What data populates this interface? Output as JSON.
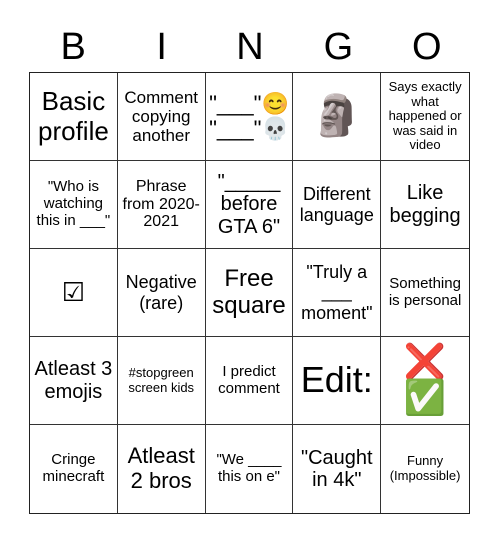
{
  "header": {
    "letters": [
      "B",
      "I",
      "N",
      "G",
      "O"
    ]
  },
  "board": {
    "cells": [
      "Basic profile",
      "Comment copying another",
      "\"___\"😊 \"___\"💀",
      "🗿",
      "Says exactly what happened or was said in video",
      "\"Who is watching this in ___\"",
      "Phrase from 2020-2021",
      "\"_____ before GTA 6\"",
      "Different language",
      "Like begging",
      "☑",
      "Negative (rare)",
      "Free square",
      "\"Truly a ___ moment\"",
      "Something is personal",
      "Atleast 3 emojis",
      "#stopgreen screen kids",
      "I predict comment",
      "Edit:",
      "❌ ✅",
      "Cringe minecraft",
      "Atleast 2 bros",
      "\"We ____ this on e\"",
      "\"Caught in 4k\"",
      "Funny (Impossible)"
    ]
  }
}
